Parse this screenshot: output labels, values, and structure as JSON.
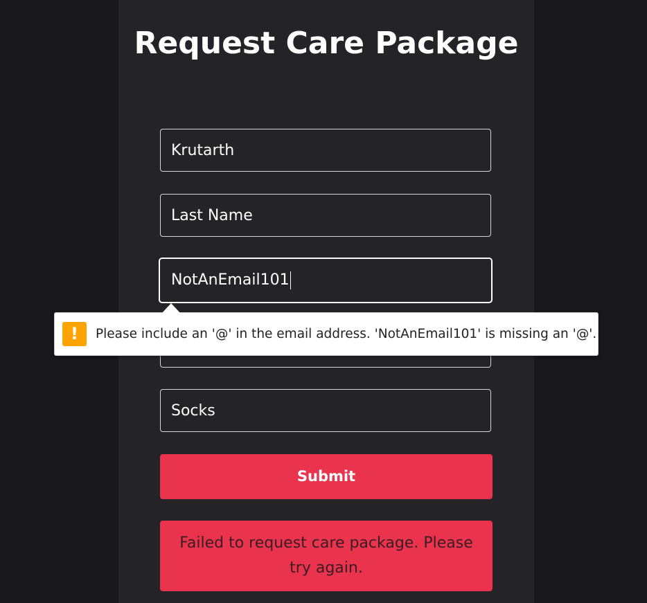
{
  "form": {
    "title": "Request Care Package",
    "fields": {
      "first_name": {
        "value": "Krutarth"
      },
      "last_name": {
        "placeholder": "Last Name"
      },
      "email": {
        "value": "NotAnEmail101"
      },
      "item": {
        "value": "Socks"
      }
    },
    "submit_label": "Submit",
    "error_message": "Failed to request care package. Please try again."
  },
  "validation_tooltip": {
    "icon": "warning-icon",
    "icon_glyph": "!",
    "message": "Please include an '@' in the email address. 'NotAnEmail101' is missing an '@'."
  },
  "colors": {
    "background": "#18181c",
    "card": "#242428",
    "accent": "#ea344d",
    "warning": "#ffa300"
  }
}
